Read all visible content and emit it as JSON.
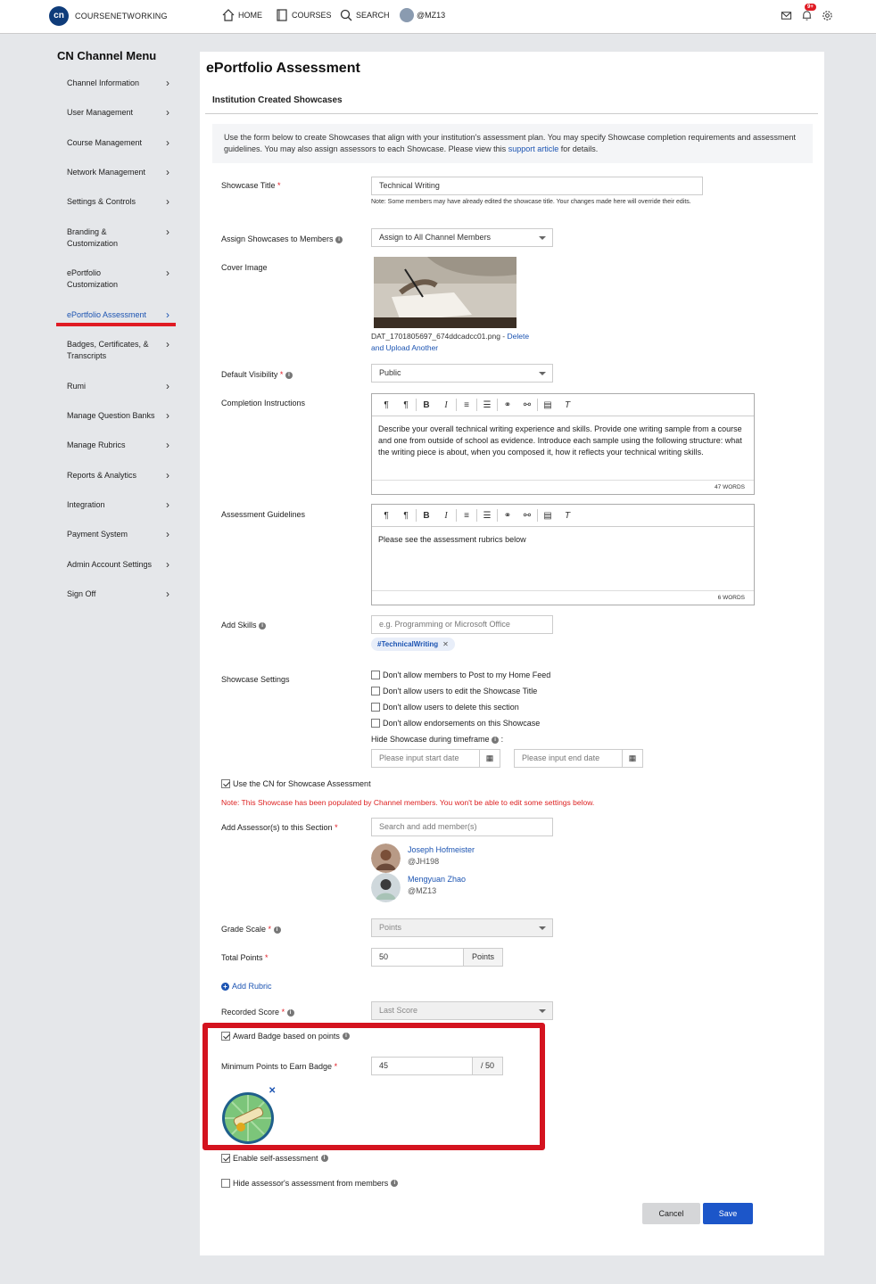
{
  "topbar": {
    "logo": "cn",
    "brand": "COURSENETWORKING",
    "nav": {
      "home": "HOME",
      "courses": "COURSES",
      "search": "SEARCH",
      "profile": "@MZ13"
    },
    "notifications_count": "9+"
  },
  "sidebar": {
    "title": "CN Channel Menu",
    "items": [
      {
        "label": "Channel Information"
      },
      {
        "label": "User Management"
      },
      {
        "label": "Course Management"
      },
      {
        "label": "Network Management"
      },
      {
        "label": "Settings & Controls"
      },
      {
        "label": "Branding & Customization"
      },
      {
        "label": "ePortfolio Customization"
      },
      {
        "label": "ePortfolio Assessment"
      },
      {
        "label": "Badges, Certificates, & Transcripts"
      },
      {
        "label": "Rumi"
      },
      {
        "label": "Manage Question Banks"
      },
      {
        "label": "Manage Rubrics"
      },
      {
        "label": "Reports & Analytics"
      },
      {
        "label": "Integration"
      },
      {
        "label": "Payment System"
      },
      {
        "label": "Admin Account Settings"
      },
      {
        "label": "Sign Off"
      }
    ]
  },
  "main": {
    "title": "ePortfolio Assessment",
    "section_title": "Institution Created Showcases",
    "info_text": "Use the form below to create Showcases that align with your institution's assessment plan. You may specify Showcase completion requirements and assessment guidelines. You may also assign assessors to each Showcase. Please view this",
    "info_link": "support article",
    "info_tail": "for details.",
    "showcase_title_label": "Showcase Title",
    "showcase_title_value": "Technical Writing",
    "showcase_title_note": "Note: Some members may have already edited the showcase title. Your changes made here will override their edits.",
    "assign_label": "Assign Showcases to Members",
    "assign_value": "Assign to All Channel Members",
    "cover_label": "Cover Image",
    "cover_filename": "DAT_1701805697_674ddcadcc01.png -",
    "cover_delete": "Delete",
    "cover_upload": "and Upload Another",
    "visibility_label": "Default Visibility",
    "visibility_value": "Public",
    "completion_label": "Completion Instructions",
    "completion_text": "Describe your overall technical writing experience and skills. Provide one writing sample from a course and one from outside of school as evidence. Introduce each sample using the following structure: what the writing piece is about, when you composed it, how it reflects your technical writing skills.",
    "completion_words": "47 WORDS",
    "guidelines_label": "Assessment Guidelines",
    "guidelines_text": "Please see the assessment rubrics below",
    "guidelines_words": "6 WORDS",
    "skills_label": "Add Skills",
    "skills_placeholder": "e.g. Programming or Microsoft Office",
    "skill_chip": "#TechnicalWriting",
    "settings_label": "Showcase Settings",
    "settings": [
      "Don't allow members to Post to my Home Feed",
      "Don't allow users to edit the Showcase Title",
      "Don't allow users to delete this section",
      "Don't allow endorsements on this Showcase"
    ],
    "hide_timeframe": "Hide Showcase during timeframe",
    "start_date_placeholder": "Please input start date",
    "end_date_placeholder": "Please input end date",
    "use_cn_label": "Use the CN for Showcase Assessment",
    "populated_note": "Note: This Showcase has been populated by Channel members. You won't be able to edit some settings below.",
    "assessor_label": "Add Assessor(s) to this Section",
    "assessor_placeholder": "Search and add member(s)",
    "assessors": [
      {
        "name": "Joseph Hofmeister",
        "handle": "@JH198"
      },
      {
        "name": "Mengyuan Zhao",
        "handle": "@MZ13"
      }
    ],
    "grade_scale_label": "Grade Scale",
    "grade_scale_value": "Points",
    "total_points_label": "Total Points",
    "total_points_value": "50",
    "total_points_unit": "Points",
    "add_rubric": "Add Rubric",
    "recorded_score_label": "Recorded Score",
    "recorded_score_value": "Last Score",
    "award_badge_label": "Award Badge based on points",
    "min_points_label": "Minimum Points to Earn Badge",
    "min_points_value": "45",
    "min_points_suffix": "/ 50",
    "self_assessment_label": "Enable self-assessment",
    "hide_assessor_label": "Hide assessor's assessment from members",
    "cancel": "Cancel",
    "save": "Save"
  },
  "colors": {
    "accent": "#1c54b2",
    "highlight": "#d4131f",
    "save_button": "#1c56c9"
  }
}
